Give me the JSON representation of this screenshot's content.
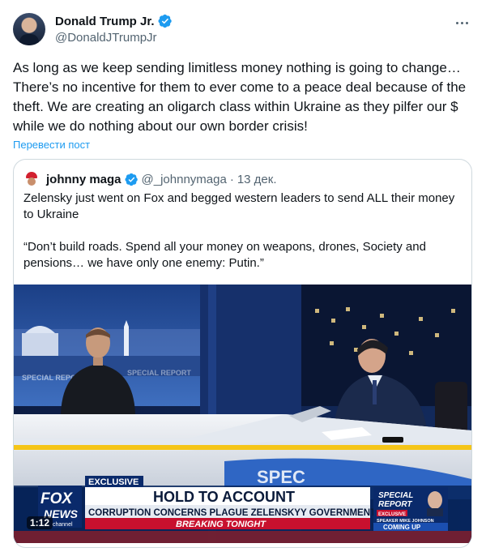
{
  "author": {
    "display_name": "Donald Trump Jr.",
    "handle": "@DonaldJTrumpJr",
    "avatar_icon": "profile-photo",
    "verified_icon": "verified-badge-icon",
    "verified_color": "#1d9bf0"
  },
  "tweet": {
    "text": "As long as we keep sending limitless money nothing is going to change… There’s no incentive for them to ever come to a peace deal because of the theft. We are creating an oligarch class within Ukraine as they pilfer our $ while we do nothing about our own border crisis!",
    "translate_label": "Перевести пост",
    "more_icon": "more-options-icon"
  },
  "quote": {
    "display_name": "johnny maga",
    "handle": "@_johnnymaga",
    "separator": "·",
    "time": "13 дек.",
    "text_paragraphs": [
      "Zelensky just went on Fox and begged western leaders to send ALL their money to Ukraine",
      "“Don’t build roads. Spend all your money on weapons, drones, Society and pensions… we have only one enemy: Putin.”"
    ]
  },
  "video": {
    "timestamp": "1:12",
    "channel_logo_line1": "FOX",
    "channel_logo_line2": "NEWS",
    "channel_logo_line3": "channel",
    "exclusive_tag": "EXCLUSIVE",
    "headline": "HOLD TO ACCOUNT",
    "subheadline": "CORRUPTION CONCERNS PLAGUE ZELENSKYY GOVERNMENT",
    "breaking_label": "BREAKING TONIGHT",
    "promo_title_line1": "SPECIAL",
    "promo_title_line2": "REPORT",
    "promo_exclusive": "EXCLUSIVE",
    "promo_guest": "SPEAKER MIKE JOHNSON",
    "promo_coming": "COMING UP",
    "set_sign": "SPECIAL REPORT",
    "desk_sign": "SPEC"
  },
  "colors": {
    "text_primary": "#0f1419",
    "text_secondary": "#536471",
    "link": "#1d9bf0",
    "fox_red": "#c8102e",
    "fox_blue": "#0a2a6b"
  }
}
